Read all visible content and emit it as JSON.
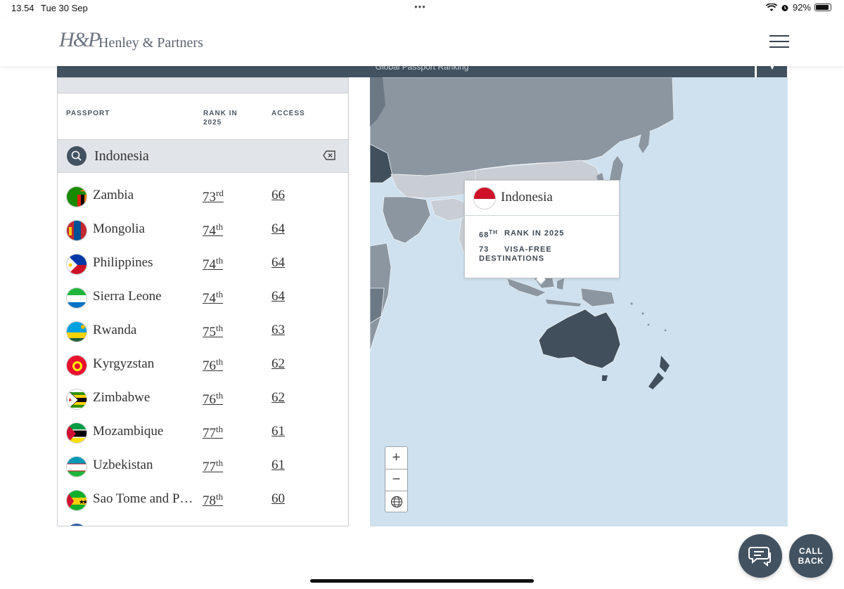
{
  "status_bar": {
    "time": "13.54",
    "date": "Tue 30 Sep",
    "dots": "•••",
    "battery_percent": "92%",
    "battery_level": 0.92
  },
  "header": {
    "logo_mark": "H&P",
    "logo_text": "Henley & Partners"
  },
  "title_bar": {
    "label": "Global Passport Ranking"
  },
  "table": {
    "columns": {
      "passport": "PASSPORT",
      "rank_line1": "RANK IN",
      "rank_line2": "2025",
      "access": "ACCESS"
    },
    "search": {
      "value": "Indonesia"
    },
    "rows": [
      {
        "country": "Zambia",
        "rank": "73",
        "suffix": "rd",
        "access": "66"
      },
      {
        "country": "Mongolia",
        "rank": "74",
        "suffix": "th",
        "access": "64"
      },
      {
        "country": "Philippines",
        "rank": "74",
        "suffix": "th",
        "access": "64"
      },
      {
        "country": "Sierra Leone",
        "rank": "74",
        "suffix": "th",
        "access": "64"
      },
      {
        "country": "Rwanda",
        "rank": "75",
        "suffix": "th",
        "access": "63"
      },
      {
        "country": "Kyrgyzstan",
        "rank": "76",
        "suffix": "th",
        "access": "62"
      },
      {
        "country": "Zimbabwe",
        "rank": "76",
        "suffix": "th",
        "access": "62"
      },
      {
        "country": "Mozambique",
        "rank": "77",
        "suffix": "th",
        "access": "61"
      },
      {
        "country": "Uzbekistan",
        "rank": "77",
        "suffix": "th",
        "access": "61"
      },
      {
        "country": "Sao Tome and P…",
        "rank": "78",
        "suffix": "th",
        "access": "60"
      }
    ]
  },
  "tooltip": {
    "country": "Indonesia",
    "rank": "68",
    "rank_suffix": "TH",
    "rank_label": "RANK IN 2025",
    "destinations": "73",
    "destinations_label_1": "VISA-FREE",
    "destinations_label_2": "DESTINATIONS"
  },
  "zoom": {
    "plus": "+",
    "minus": "−"
  },
  "buttons": {
    "call_line1": "CALL",
    "call_line2": "BACK"
  },
  "colors": {
    "brand_dark": "#435260",
    "panel_gray": "#e1e4e8",
    "ocean": "#cfe1ee",
    "land_dark": "#414f5c",
    "land_mid": "#8c96a0",
    "land_light": "#c8ced4"
  },
  "icons": [
    "search-icon",
    "clear-icon",
    "globe-icon",
    "chat-icon",
    "wifi-icon",
    "alarm-icon",
    "battery-icon",
    "hamburger-icon"
  ]
}
